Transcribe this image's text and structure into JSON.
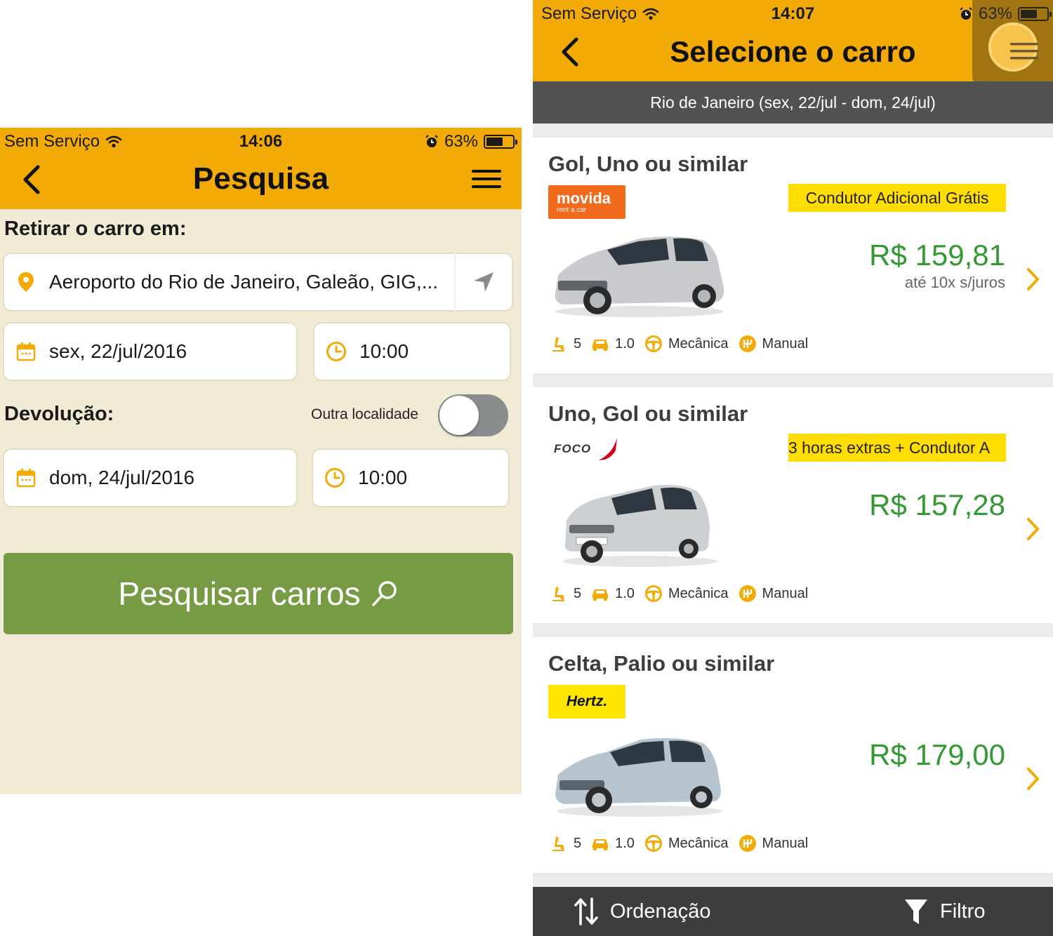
{
  "left_screen": {
    "status": {
      "carrier": "Sem Serviço",
      "time": "14:06",
      "battery": "63%",
      "battery_level": 0.63
    },
    "nav": {
      "title": "Pesquisa",
      "back_icon": "chevron-left-icon",
      "menu_icon": "hamburger-menu-icon"
    },
    "pickup": {
      "label": "Retirar o carro em:",
      "location": "Aeroporto do Rio de Janeiro, Galeão, GIG,...",
      "date": "sex, 22/jul/2016",
      "time": "10:00"
    },
    "return": {
      "label": "Devolução:",
      "toggle_label": "Outra localidade",
      "toggle_on": false,
      "date": "dom, 24/jul/2016",
      "time": "10:00"
    },
    "search_button": "Pesquisar carros"
  },
  "right_screen": {
    "status": {
      "carrier": "Sem Serviço",
      "time": "14:07",
      "battery": "63%",
      "battery_level": 0.63
    },
    "nav": {
      "title": "Selecione o carro"
    },
    "subheader": "Rio de Janeiro (sex, 22/jul - dom, 24/jul)",
    "cars": [
      {
        "name": "Gol, Uno ou similar",
        "brand": "movida",
        "brand_logo_text": "movida",
        "brand_logo_subtext": "rent a car",
        "promo": "Condutor Adicional Grátis",
        "price": "R$ 159,81",
        "price_note": "até 10x s/juros",
        "specs": {
          "seats": "5",
          "engine": "1.0",
          "steering": "Mecânica",
          "transmission": "Manual"
        }
      },
      {
        "name": "Uno, Gol ou similar",
        "brand": "foco",
        "brand_logo_text": "FOCO",
        "promo": "3 horas extras + Condutor A",
        "price": "R$ 157,28",
        "price_note": "",
        "specs": {
          "seats": "5",
          "engine": "1.0",
          "steering": "Mecânica",
          "transmission": "Manual"
        }
      },
      {
        "name": "Celta, Palio ou similar",
        "brand": "hertz",
        "brand_logo_text": "Hertz.",
        "promo": "",
        "price": "R$ 179,00",
        "price_note": "",
        "specs": {
          "seats": "5",
          "engine": "1.0",
          "steering": "Mecânica",
          "transmission": "Manual"
        }
      }
    ],
    "bottom_bar": {
      "sort_label": "Ordenação",
      "filter_label": "Filtro"
    }
  },
  "colors": {
    "accent_yellow": "#f2aa07",
    "cream_background": "#f1ebd5",
    "search_green": "#779b44",
    "price_green": "#339933",
    "promo_yellow": "#ffdd00",
    "dark_bar": "#3d3d3d"
  }
}
